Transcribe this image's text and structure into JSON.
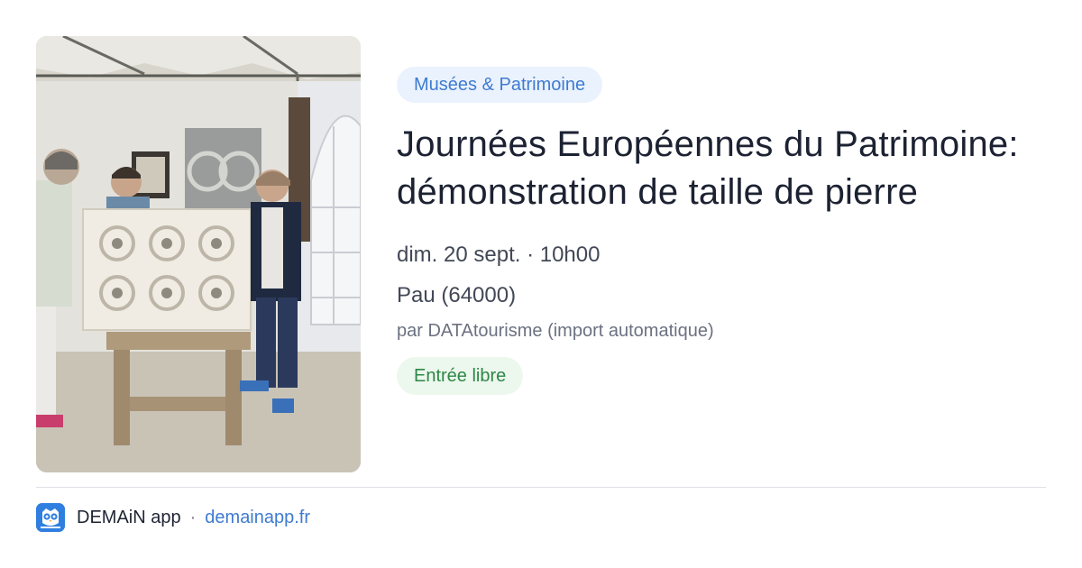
{
  "event": {
    "category": "Musées & Patrimoine",
    "title": "Journées Européennes du Patrimoine: démonstration de taille de pierre",
    "date": "dim. 20 sept. · 10h00",
    "location": "Pau (64000)",
    "source": "par DATAtourisme (import automatique)",
    "price": "Entrée libre"
  },
  "footer": {
    "app_name": "DEMAiN app",
    "separator": "·",
    "domain": "demainapp.fr",
    "logo_icon": "owl-icon"
  },
  "photo": {
    "subject": "event-photo"
  },
  "colors": {
    "category_bg": "#eaf2fd",
    "category_text": "#3f7bd0",
    "price_bg": "#ecf7ee",
    "price_text": "#2e8745",
    "title_text": "#1c2232",
    "link": "#3f7bd0",
    "logo_bg": "#2f7fe0"
  }
}
